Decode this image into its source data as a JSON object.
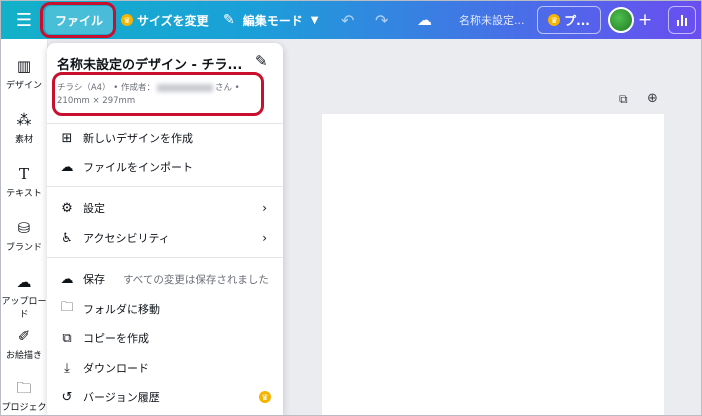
{
  "topbar": {
    "file_label": "ファイル",
    "resize_label": "サイズを変更",
    "edit_mode_label": "編集モード",
    "doc_name": "名称未設定...",
    "pro_label": "プ..."
  },
  "sidebar": {
    "items": [
      {
        "label": "デザイン"
      },
      {
        "label": "素材"
      },
      {
        "label": "テキスト"
      },
      {
        "label": "ブランド"
      },
      {
        "label": "アップロード"
      },
      {
        "label": "お絵描き"
      },
      {
        "label": "プロジェクト"
      }
    ]
  },
  "menu": {
    "title": "名称未設定のデザイン - チラ...",
    "meta_type": "チラシ（A4） • 作成者：",
    "meta_suffix": "さん •",
    "meta_size": "210mm × 297mm",
    "items": {
      "new_design": "新しいデザインを作成",
      "import_file": "ファイルをインポート",
      "settings": "設定",
      "accessibility": "アクセシビリティ",
      "save": "保存",
      "save_status": "すべての変更は保存されました",
      "move_folder": "フォルダに移動",
      "make_copy": "コピーを作成",
      "download": "ダウンロード",
      "version_history": "バージョン履歴"
    }
  }
}
